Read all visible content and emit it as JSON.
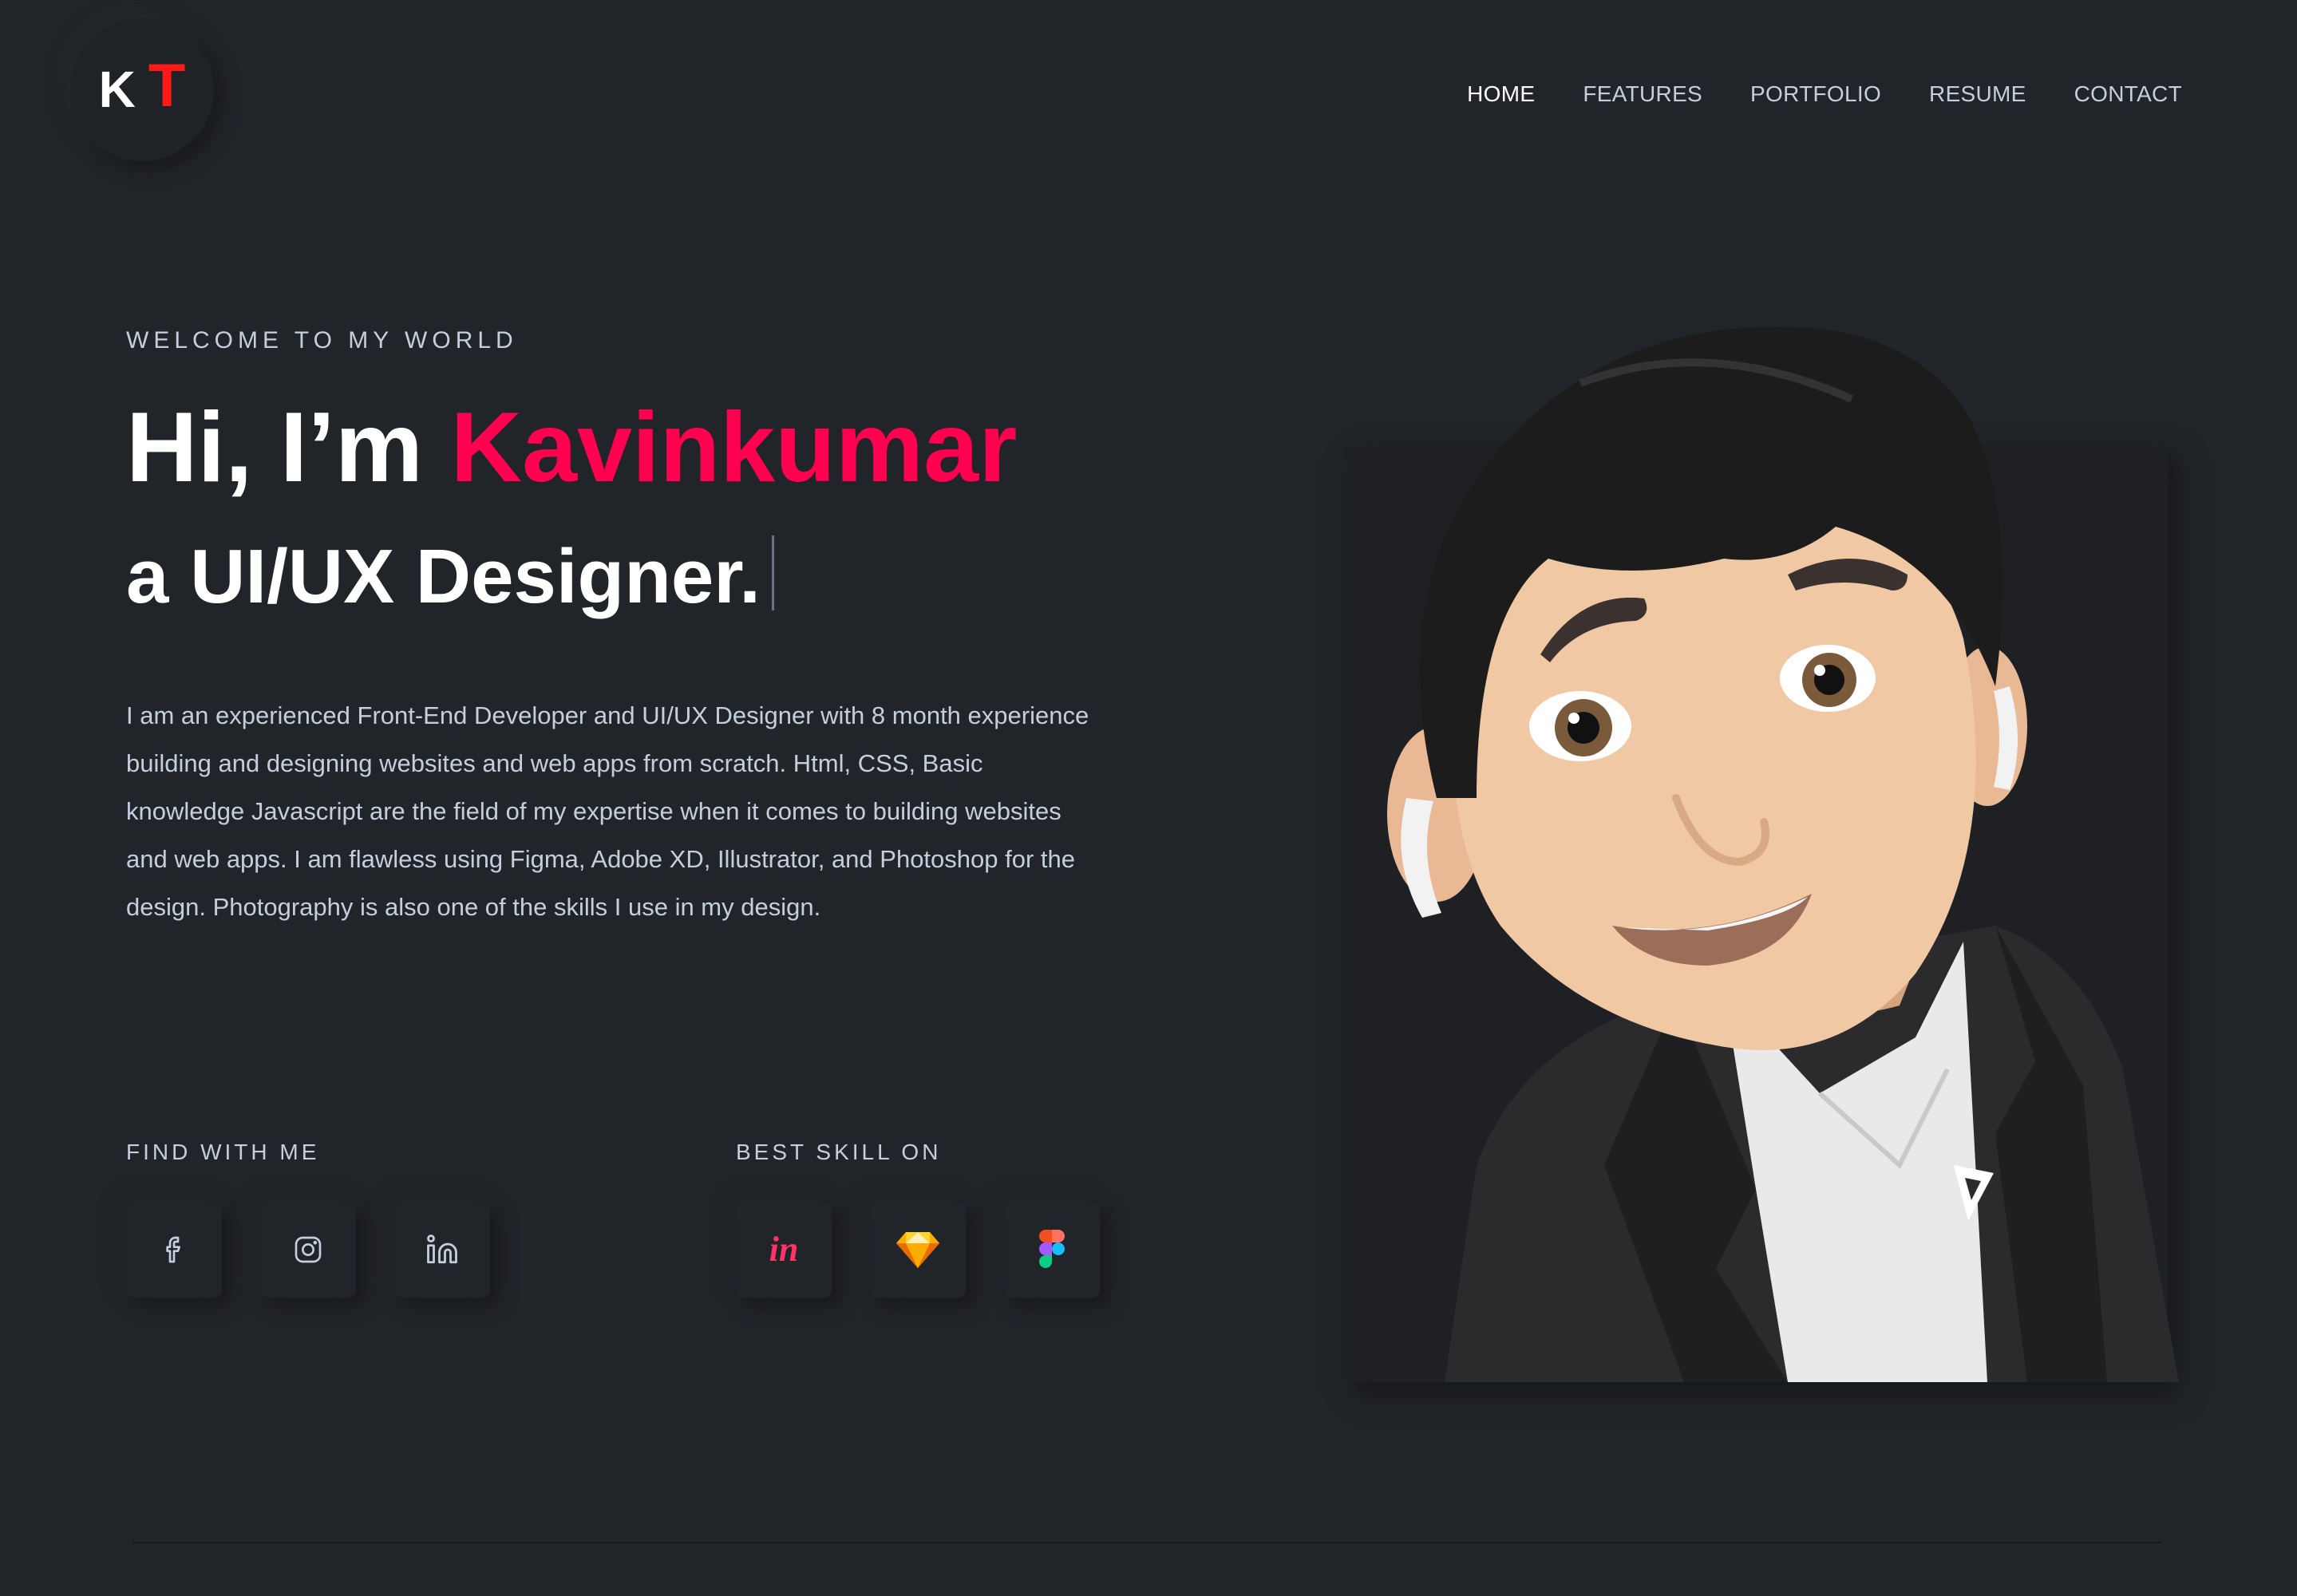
{
  "logo": {
    "letter1": "K",
    "letter2": "T"
  },
  "nav": {
    "items": [
      "HOME",
      "FEATURES",
      "PORTFOLIO",
      "RESUME",
      "CONTACT"
    ],
    "active": "HOME"
  },
  "hero": {
    "welcome": "WELCOME TO MY WORLD",
    "greeting": "Hi, I’m ",
    "name": "Kavinkumar",
    "role": "a UI/UX Designer.",
    "bio": "I am an experienced Front-End Developer and UI/UX Designer with 8 month experience building and designing websites and web apps from scratch. Html, CSS, Basic knowledge Javascript are the field of my expertise when it comes to building websites and web apps. I am flawless using Figma, Adobe XD, Illustrator, and Photoshop for the design. Photography is also one of the skills I use in my design."
  },
  "find_with_me": {
    "label": "FIND WITH ME",
    "icons": [
      "facebook-icon",
      "instagram-icon",
      "linkedin-icon"
    ]
  },
  "best_skill_on": {
    "label": "BEST SKILL ON",
    "icons": [
      "invision-icon",
      "sketch-icon",
      "figma-icon"
    ]
  },
  "colors": {
    "background": "#212428",
    "accent": "#ff014f",
    "logo_t": "#ff1a1a",
    "text": "#c4cfde",
    "heading": "#ffffff"
  }
}
